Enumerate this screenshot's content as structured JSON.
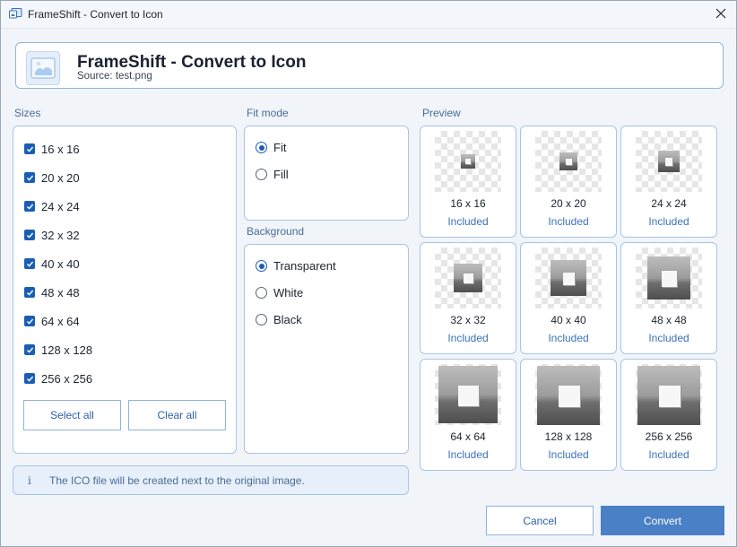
{
  "window": {
    "title": "FrameShift - Convert to Icon"
  },
  "header": {
    "title": "FrameShift - Convert to Icon",
    "source": "Source: test.png"
  },
  "sizes": {
    "label": "Sizes",
    "items": [
      "16 x 16",
      "20 x 20",
      "24 x 24",
      "32 x 32",
      "40 x 40",
      "48 x 48",
      "64 x 64",
      "128 x 128",
      "256 x 256"
    ],
    "select_all": "Select all",
    "clear_all": "Clear all"
  },
  "fit_mode": {
    "label": "Fit mode",
    "options": [
      "Fit",
      "Fill"
    ],
    "selected": "Fit"
  },
  "background": {
    "label": "Background",
    "options": [
      "Transparent",
      "White",
      "Black"
    ],
    "selected": "Transparent"
  },
  "preview": {
    "label": "Preview",
    "tiles": [
      {
        "size": "16 x 16",
        "status": "Included"
      },
      {
        "size": "20 x 20",
        "status": "Included"
      },
      {
        "size": "24 x 24",
        "status": "Included"
      },
      {
        "size": "32 x 32",
        "status": "Included"
      },
      {
        "size": "40 x 40",
        "status": "Included"
      },
      {
        "size": "48 x 48",
        "status": "Included"
      },
      {
        "size": "64 x 64",
        "status": "Included"
      },
      {
        "size": "128 x 128",
        "status": "Included"
      },
      {
        "size": "256 x 256",
        "status": "Included"
      }
    ]
  },
  "info": {
    "icon": "i",
    "text": "The ICO file will be created next to the original image."
  },
  "actions": {
    "cancel": "Cancel",
    "convert": "Convert"
  },
  "colors": {
    "accent": "#1a5eb4",
    "primary_button": "#4a80c6",
    "panel_border": "#a9c4e3"
  }
}
